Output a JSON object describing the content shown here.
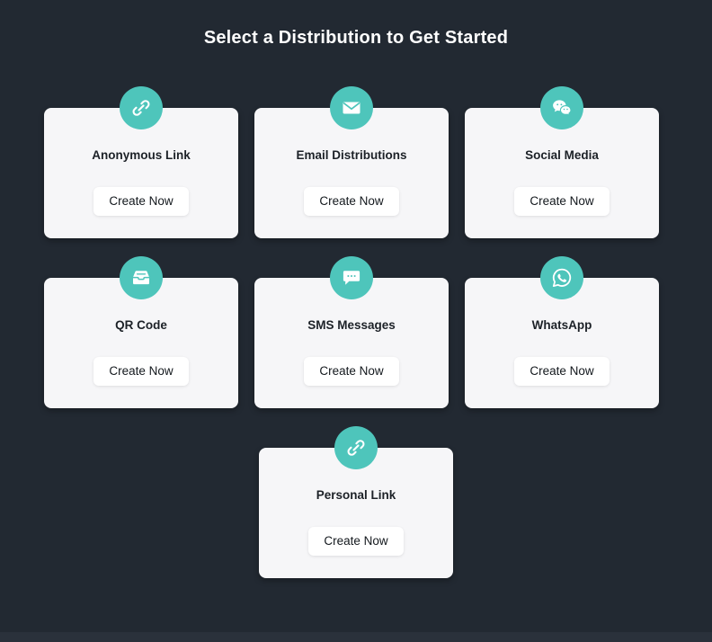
{
  "page": {
    "title": "Select a Distribution to Get Started",
    "background_color": "#222932",
    "accent_color": "#4ec5bb",
    "card_color": "#f6f6f8",
    "button_color": "#ffffff"
  },
  "cards": [
    {
      "label": "Anonymous Link",
      "icon": "link-icon",
      "button_label": "Create Now"
    },
    {
      "label": "Email Distributions",
      "icon": "envelope-icon",
      "button_label": "Create Now"
    },
    {
      "label": "Social Media",
      "icon": "chat-bubbles-icon",
      "button_label": "Create Now"
    },
    {
      "label": "QR Code",
      "icon": "inbox-tray-icon",
      "button_label": "Create Now"
    },
    {
      "label": "SMS Messages",
      "icon": "sms-bubble-icon",
      "button_label": "Create Now"
    },
    {
      "label": "WhatsApp",
      "icon": "whatsapp-icon",
      "button_label": "Create Now"
    },
    {
      "label": "Personal Link",
      "icon": "link-icon",
      "button_label": "Create Now"
    }
  ]
}
